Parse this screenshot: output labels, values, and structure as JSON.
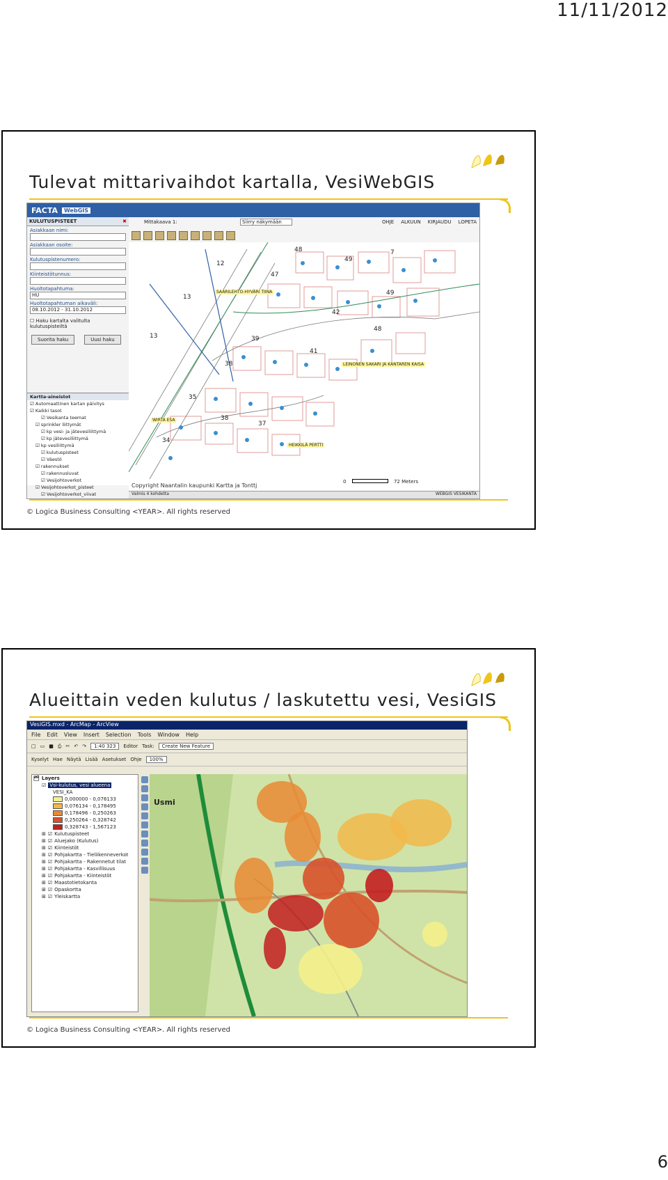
{
  "page": {
    "date": "11/11/2012",
    "page_number": "6"
  },
  "slides": [
    {
      "title": "Tulevat mittarivaihdot kartalla, VesiWebGIS",
      "footer": "© Logica Business Consulting <YEAR>. All rights reserved",
      "screenshot": {
        "brand": "FACTA",
        "product": "WebGIS",
        "panel_title": "KULUTUSPISTEET",
        "fields": [
          {
            "label": "Asiakkaan nimi:",
            "value": ""
          },
          {
            "label": "Asiakkaan osoite:",
            "value": ""
          },
          {
            "label": "Kulutuspistenumero:",
            "value": ""
          },
          {
            "label": "Kiinteistötunnus:",
            "value": ""
          },
          {
            "label": "Huoltotapahtuma:",
            "value": "HU"
          },
          {
            "label": "Huoltotapahtuman aikaväli:",
            "value": "08.10.2012 - 31.10.2012"
          }
        ],
        "checkbox_label": "Haku kartalta valitulta kulutuspisteiltä",
        "search_button": "Suorita haku",
        "new_search_button": "Uusi haku",
        "layers_title": "Kartta-aineistot",
        "layers": [
          "Automaattinen kartan päivitys",
          "Kaikki tasot",
          "Vesikanta teemat",
          "sprinkler liittymät",
          "kp vesi- ja jätevesiliittymä",
          "kp jätevesiliittymä",
          "kp vesiliittymä",
          "kulutuspisteet",
          "Väestö",
          "rakennukset",
          "rakennusluvat",
          "Vesijohtoverkot",
          "Vesijohtoverkot_pisteet",
          "Vesijohtoverkot_viivat"
        ],
        "scale_label": "Mittakaava 1:",
        "view_select": "Siirry näkymään",
        "menu": [
          "OHJE",
          "ALKUUN",
          "KIRJAUDU",
          "LOPETA"
        ],
        "map_numbers": [
          "12",
          "48",
          "49",
          "7",
          "47",
          "13",
          "49",
          "42",
          "13",
          "39",
          "48",
          "41",
          "38",
          "35",
          "38",
          "37",
          "34"
        ],
        "map_labels": [
          "SAARILEHTO-HYVÄRI TIINA",
          "LEINONEN SAKARI JA KANTAREN KAISA",
          "WIRTA ESA",
          "HEIKKILÄ PERTTI"
        ],
        "map_copyright": "Copyright Naantalin kaupunki Kartta ja Tonttj",
        "scale_text": "72 Meters",
        "scale_zero": "0",
        "status_left": "Valmis 4 kohdetta",
        "status_right": "WEBGIS  VESIKANTA"
      }
    },
    {
      "title": "Alueittain veden kulutus / laskutettu vesi, VesiGIS",
      "footer": "© Logica Business Consulting <YEAR>. All rights reserved",
      "screenshot": {
        "window_title": "VesiGIS.mxd - ArcMap - ArcView",
        "menu": [
          "File",
          "Edit",
          "View",
          "Insert",
          "Selection",
          "Tools",
          "Window",
          "Help"
        ],
        "scale_value": "1:40 323",
        "editor_label": "Editor",
        "task_label": "Task:",
        "task_value": "Create New Feature",
        "toolbar2": [
          "Kyselyt",
          "Hae",
          "Näytä",
          "Lisää",
          "Asetukset",
          "Ohje"
        ],
        "zoom_value": "100%",
        "toc_title": "Layers",
        "toc_active_layer": "Vsi-kulutus, vesi alueena",
        "legend_field": "VESI_KA",
        "legend": [
          {
            "label": "0,000000 - 0,076133",
            "color": "#f4f08a"
          },
          {
            "label": "0,076134 - 0,178495",
            "color": "#f2b84a"
          },
          {
            "label": "0,178496 - 0,250263",
            "color": "#e98a34"
          },
          {
            "label": "0,250264 - 0,328742",
            "color": "#d8512a"
          },
          {
            "label": "0,328743 - 1,567123",
            "color": "#c21f1f"
          }
        ],
        "other_layers": [
          "Kulutuspisteet",
          "Aluejako (Kulutus)",
          "Kiinteistöt",
          "Pohjakartta - Tieliikenneverkot",
          "Pohjakartta - Rakennetut tilat",
          "Pohjakartta - Kasvillisuus",
          "Pohjakartta - Kiinteistöt",
          "Maastotietokanta",
          "Opaskortta",
          "Yleiskartta"
        ],
        "map_place": "Usmi"
      }
    }
  ]
}
